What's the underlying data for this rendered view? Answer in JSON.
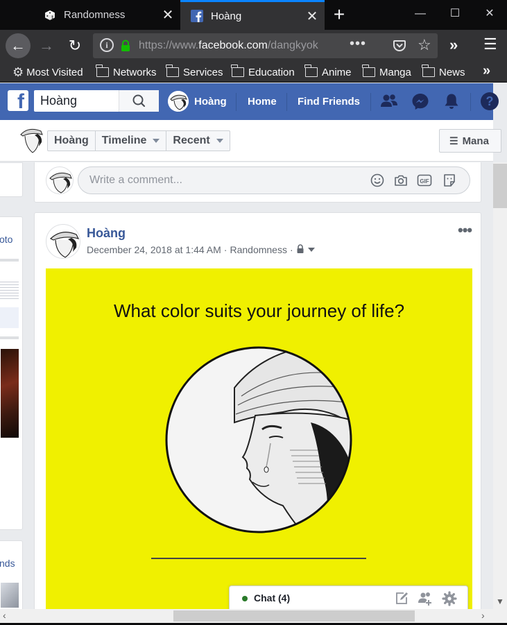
{
  "browser": {
    "tabs": [
      {
        "title": "Randomness",
        "icon": "dice-icon"
      },
      {
        "title": "Hoàng",
        "icon": "facebook-icon",
        "active": true
      }
    ],
    "url": {
      "prefix": "https://www.",
      "domain": "facebook.com",
      "path": "/dangkyok"
    },
    "bookmarks": [
      "Most Visited",
      "Networks",
      "Services",
      "Education",
      "Anime",
      "Manga",
      "News"
    ]
  },
  "fb": {
    "search_value": "Hoàng",
    "profile_name": "Hoàng",
    "nav": [
      "Home",
      "Find Friends"
    ],
    "brand_color": "#4267b2"
  },
  "subnav": {
    "name": "Hoàng",
    "timeline": "Timeline",
    "recent": "Recent",
    "manage": "Mana"
  },
  "comment": {
    "placeholder": "Write a comment..."
  },
  "post": {
    "author": "Hoàng",
    "date": "December 24, 2018 at 1:44 AM",
    "group": "Randomness",
    "image": {
      "caption": "What color suits your journey of life?",
      "bg_color": "#f0f000"
    }
  },
  "sidebar_fragments": {
    "a": "oto",
    "b": "nds"
  },
  "chat": {
    "label": "Chat (4)"
  }
}
